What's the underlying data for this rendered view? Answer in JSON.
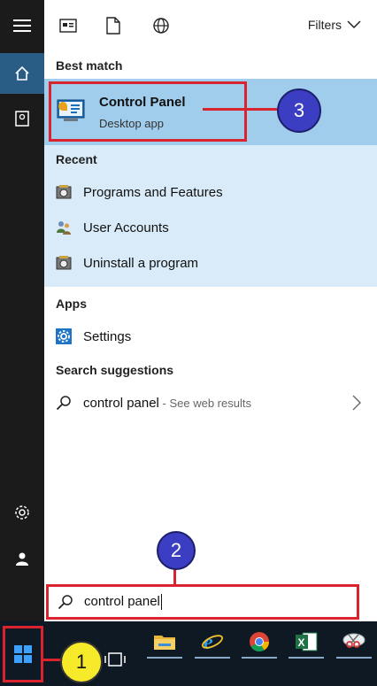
{
  "topbar": {
    "filters_label": "Filters"
  },
  "best_match": {
    "section_label": "Best match",
    "title": "Control Panel",
    "subtitle": "Desktop app"
  },
  "recent": {
    "section_label": "Recent",
    "items": [
      {
        "label": "Programs and Features",
        "icon": "programs-features-icon"
      },
      {
        "label": "User Accounts",
        "icon": "user-accounts-icon"
      },
      {
        "label": "Uninstall a program",
        "icon": "uninstall-program-icon"
      }
    ]
  },
  "apps": {
    "section_label": "Apps",
    "items": [
      {
        "label": "Settings",
        "icon": "settings-gear-icon"
      }
    ]
  },
  "suggestions": {
    "section_label": "Search suggestions",
    "items": [
      {
        "query": "control panel",
        "hint": " - See web results"
      }
    ]
  },
  "search": {
    "value": "control panel"
  },
  "markers": {
    "m1": "1",
    "m2": "2",
    "m3": "3"
  },
  "colors": {
    "highlight": "#9fcdeb",
    "recent_bg": "#d9ebf8",
    "annotation_red": "#d9232e",
    "marker_blue": "#3b3ec2",
    "marker_yellow": "#f6ea2a"
  }
}
